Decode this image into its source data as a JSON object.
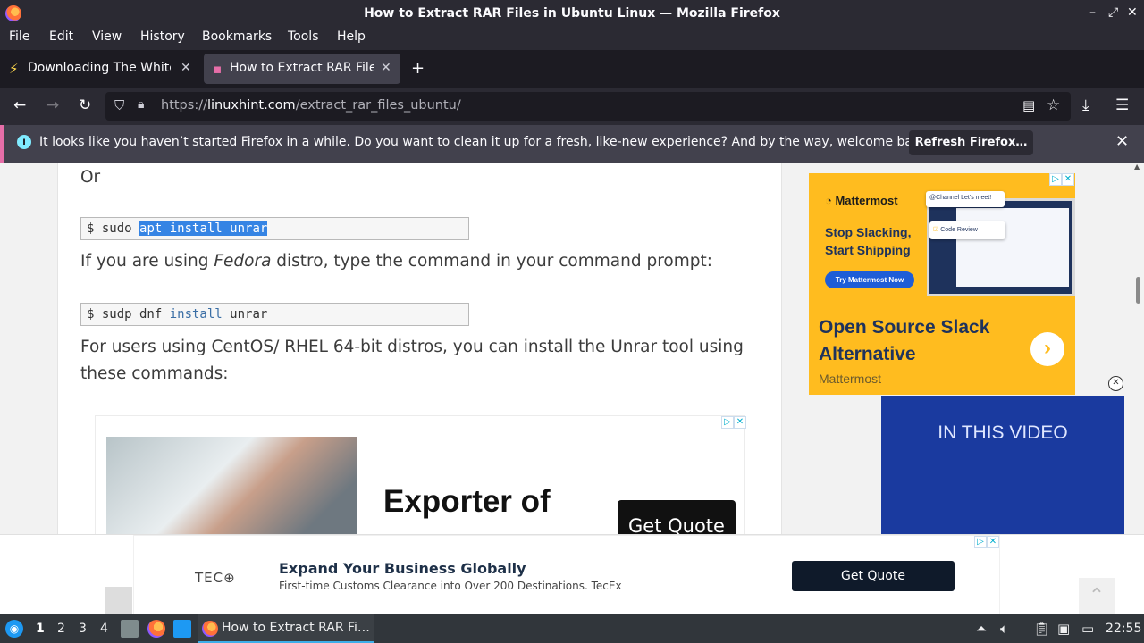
{
  "window": {
    "title": "How to Extract RAR Files in Ubuntu Linux — Mozilla Firefox",
    "controls": [
      "–",
      "⤢",
      "✕"
    ]
  },
  "menubar": {
    "items": [
      "File",
      "Edit",
      "View",
      "History",
      "Bookmarks",
      "Tools",
      "Help"
    ]
  },
  "tabs": [
    {
      "label": "Downloading The White H",
      "active": false
    },
    {
      "label": "How to Extract RAR Files in",
      "active": true
    }
  ],
  "navbar": {
    "url_prefix": "https://",
    "url_domain": "linuxhint.com",
    "url_path": "/extract_rar_files_ubuntu/"
  },
  "notification": {
    "text": "It looks like you haven’t started Firefox in a while. Do you want to clean it up for a fresh, like-new experience? And by the way, welcome back!",
    "button": "Refresh Firefox…"
  },
  "article": {
    "or_text": "Or",
    "code1_prefix": "$ sudo ",
    "code1_selected": "apt install unrar",
    "fedora_pre": "If you are using ",
    "fedora_em": "Fedora",
    "fedora_post": " distro, type the command in your command prompt:",
    "code2_prefix": "$ sudp dnf ",
    "code2_kw": "install",
    "code2_suffix": " unrar",
    "centos_text": "For users using CentOS/ RHEL 64-bit distros, you can install the Unrar tool using these commands:"
  },
  "inline_ad": {
    "headline": "Exporter of",
    "button": "Get Quote"
  },
  "side_ad": {
    "brand": "Mattermost",
    "tagline": "Stop Slacking, Start Shipping",
    "cta": "Try Mattermost Now",
    "popup1": "@Channel Let's meet!",
    "popup2": "Code Review",
    "headline": "Open Source Slack Alternative",
    "source": "Mattermost"
  },
  "video": {
    "title": "IN THIS VIDEO"
  },
  "bottom_ad": {
    "logo": "TEC",
    "headline": "Expand Your Business Globally",
    "subtext": "First-time Customs Clearance into Over 200 Destinations. TecEx",
    "button": "Get Quote"
  },
  "taskbar": {
    "workspaces": [
      "1",
      "2",
      "3",
      "4"
    ],
    "active_workspace": "1",
    "task_label": "How to Extract RAR Fi…",
    "clock": "22:55"
  }
}
